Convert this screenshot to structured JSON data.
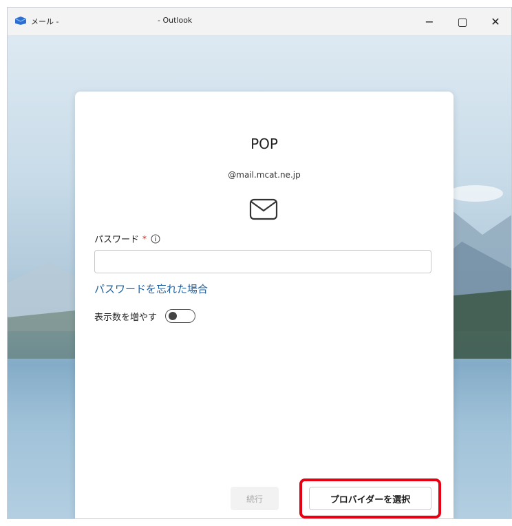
{
  "window": {
    "app_label": "メール -",
    "title": "- Outlook",
    "minimize_label": "−",
    "maximize_label": "▢",
    "close_label": "✕"
  },
  "card": {
    "title": "POP",
    "email": "@mail.mcat.ne.jp",
    "password_label": "パスワード",
    "required_mark": "*",
    "password_value": "",
    "forgot_link": "パスワードを忘れた場合",
    "show_more_label": "表示数を増やす",
    "show_more_on": false,
    "continue_label": "続行",
    "provider_button_label": "プロバイダーを選択"
  },
  "colors": {
    "accent_link": "#1f5f9e",
    "highlight_border": "#e60012",
    "required_star": "#c42b1c"
  },
  "icons": {
    "app": "outlook-icon",
    "mail": "mail-envelope-icon",
    "info": "info-circle-icon"
  }
}
